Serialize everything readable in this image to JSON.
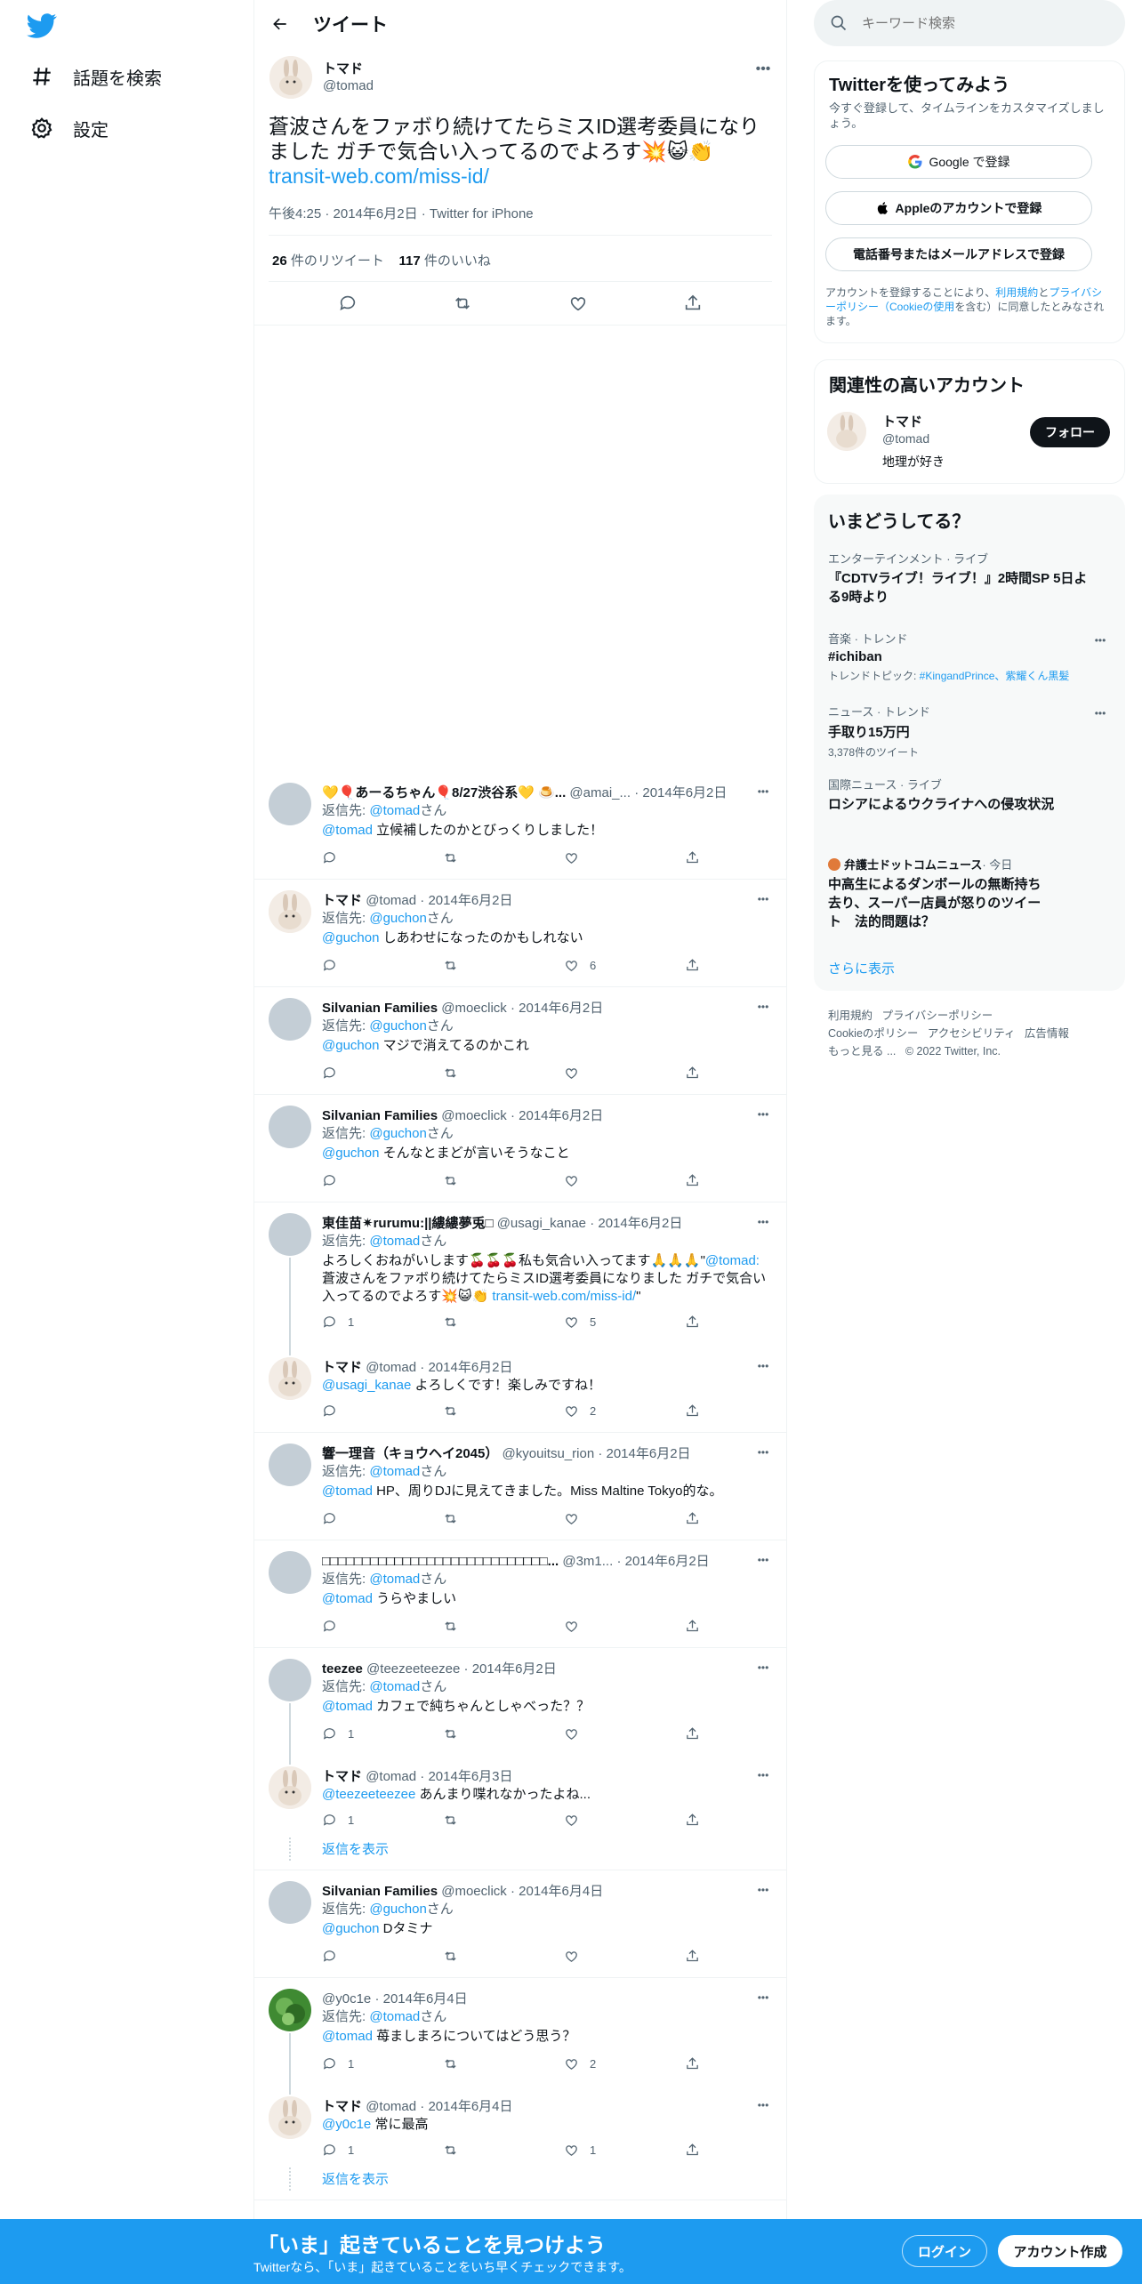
{
  "nav": {
    "explore_label": "話題を検索",
    "settings_label": "設定"
  },
  "header": {
    "title": "ツイート"
  },
  "main_tweet": {
    "name": "トマド",
    "handle": "@tomad",
    "text": "蒼波さんをファボり続けてたらミスID選考委員になりました ガチで気合い入ってるのでよろす💥😺👏",
    "link": "transit-web.com/miss-id/",
    "meta": "午後4:25 · 2014年6月2日 · Twitter for iPhone",
    "retweet_count": "26",
    "retweet_label": "件のリツイート",
    "like_count": "117",
    "like_label": "件のいいね"
  },
  "replies": [
    {
      "name": "💛🎈あーるちゃん🎈8/27渋谷系💛 🍮...",
      "handle": "@amai_...",
      "date": "· 2014年6月2日",
      "reply_prefix": "返信先:",
      "reply_to": "@tomad",
      "reply_suffix": "さん",
      "mention": "@tomad",
      "text": "立候補したのかとびっくりしました！",
      "replies": "",
      "likes": "",
      "avatar": "gray"
    },
    {
      "name": "トマド",
      "handle": "@tomad",
      "date": "· 2014年6月2日",
      "reply_prefix": "返信先:",
      "reply_to": "@guchon",
      "reply_suffix": "さん",
      "mention": "@guchon",
      "text": "しあわせになったのかもしれない",
      "replies": "",
      "likes": "6",
      "avatar": "rabbit"
    },
    {
      "name": "Silvanian Families",
      "handle": "@moeclick",
      "date": "· 2014年6月2日",
      "reply_prefix": "返信先:",
      "reply_to": "@guchon",
      "reply_suffix": "さん",
      "mention": "@guchon",
      "text": "マジで消えてるのかこれ",
      "replies": "",
      "likes": "",
      "avatar": "gray"
    },
    {
      "name": "Silvanian Families",
      "handle": "@moeclick",
      "date": "· 2014年6月2日",
      "reply_prefix": "返信先:",
      "reply_to": "@guchon",
      "reply_suffix": "さん",
      "mention": "@guchon",
      "text": "そんなとまどが言いそうなこと",
      "replies": "",
      "likes": "",
      "avatar": "gray"
    }
  ],
  "thread1": {
    "name": "東佳苗✷rurumu:||縷縷夢兎□",
    "handle": "@usagi_kanae",
    "date": "· 2014年6月2日",
    "reply_prefix": "返信先:",
    "reply_to": "@tomad",
    "reply_suffix": "さん",
    "text1": "よろしくおねがいします🍒🍒🍒私も気合い入ってます🙏🙏🙏\"",
    "mention": "@tomad:",
    "text2": "蒼波さんをファボり続けてたらミスID選考委員になりました ガチで気合い入ってるのでよろす💥😺👏",
    "link": "transit-web.com/miss-id/",
    "quote_end": "\"",
    "replies": "1",
    "likes": "5"
  },
  "thread1_reply": {
    "name": "トマド",
    "handle": "@tomad",
    "date": "· 2014年6月2日",
    "mention": "@usagi_kanae",
    "text": "よろしくです！楽しみですね！",
    "replies": "",
    "likes": "2"
  },
  "replies2": [
    {
      "name": "響一理音（キョウヘイ2045）",
      "handle": "@kyouitsu_rion",
      "date": "· 2014年6月2日",
      "reply_prefix": "返信先:",
      "reply_to": "@tomad",
      "reply_suffix": "さん",
      "mention": "@tomad",
      "text": "HP、周りDJに見えてきました。Miss Maltine Tokyo的な。",
      "replies": "",
      "likes": ""
    },
    {
      "name": "□□□□□□□□□□□□□□□□□□□□□□□□□□□□...",
      "handle": "@3m1...",
      "date": "· 2014年6月2日",
      "reply_prefix": "返信先:",
      "reply_to": "@tomad",
      "reply_suffix": "さん",
      "mention": "@tomad",
      "text": "うらやましい",
      "replies": "",
      "likes": ""
    }
  ],
  "thread2": {
    "name": "teezee",
    "handle": "@teezeeteezee",
    "date": "· 2014年6月2日",
    "reply_prefix": "返信先:",
    "reply_to": "@tomad",
    "reply_suffix": "さん",
    "mention": "@tomad",
    "text": "カフェで純ちゃんとしゃべった？？",
    "replies": "1",
    "likes": ""
  },
  "thread2_reply": {
    "name": "トマド",
    "handle": "@tomad",
    "date": "· 2014年6月3日",
    "mention": "@teezeeteezee",
    "text": "あんまり喋れなかったよね...",
    "replies": "1",
    "likes": ""
  },
  "show_replies": "返信を表示",
  "silvanian3": {
    "name": "Silvanian Families",
    "handle": "@moeclick",
    "date": "· 2014年6月4日",
    "reply_prefix": "返信先:",
    "reply_to": "@guchon",
    "reply_suffix": "さん",
    "mention": "@guchon",
    "text": "Dタミナ"
  },
  "thread3": {
    "name": "",
    "handle": "@y0c1e",
    "date": "· 2014年6月4日",
    "reply_prefix": "返信先:",
    "reply_to": "@tomad",
    "reply_suffix": "さん",
    "mention": "@tomad",
    "text": "苺ましまろについてはどう思う？",
    "replies": "1",
    "likes": "2"
  },
  "thread3_reply": {
    "name": "トマド",
    "handle": "@tomad",
    "date": "· 2014年6月4日",
    "mention": "@y0c1e",
    "text": "常に最高",
    "replies": "1",
    "likes": "1"
  },
  "search": {
    "placeholder": "キーワード検索"
  },
  "signup": {
    "title": "Twitterを使ってみよう",
    "subtitle": "今すぐ登録して、タイムラインをカスタマイズしましょう。",
    "google": "Google で登録",
    "apple": "Appleのアカウントで登録",
    "phone": "電話番号またはメールアドレスで登録",
    "terms_pre": "アカウントを登録することにより、",
    "terms_link": "利用規約",
    "terms_mid": "と",
    "privacy_link": "プライバシーポリシー",
    "cookie_link": "（Cookieの使用",
    "terms_post": "を含む）に同意したとみなされます。"
  },
  "related": {
    "title": "関連性の高いアカウント",
    "name": "トマド",
    "handle": "@tomad",
    "bio": "地理が好き",
    "follow": "フォロー"
  },
  "trends": {
    "title": "いまどうしてる？",
    "items": [
      {
        "context": "エンターテインメント · ライブ",
        "title": "『CDTVライブ！ライブ！』2時間SP 5日よる9時より"
      },
      {
        "context": "音楽 · トレンド",
        "title": "#ichiban",
        "sub_label": "トレンドトピック: ",
        "sub_links": "#KingandPrince、紫耀くん黒髪"
      },
      {
        "context": "ニュース · トレンド",
        "title": "手取り15万円",
        "sub": "3,378件のツイート"
      },
      {
        "context": "国際ニュース · ライブ",
        "title": "ロシアによるウクライナへの侵攻状況"
      },
      {
        "context_source": "弁護士ドットコムニュース",
        "context_time": " · 今日",
        "title": "中高生によるダンボールの無断持ち去り、スーパー店員が怒りのツイート　法的問題は？"
      }
    ],
    "more": "さらに表示"
  },
  "footer": {
    "l1": "利用規約",
    "l2": "プライバシーポリシー",
    "l3": "Cookieのポリシー",
    "l4": "アクセシビリティ",
    "l5": "広告情報",
    "l6": "もっと見る ...",
    "copy": "© 2022 Twitter, Inc."
  },
  "bottom_bar": {
    "title": "「いま」起きていることを見つけよう",
    "subtitle": "Twitterなら、「いま」起きていることをいち早くチェックできます。",
    "login": "ログイン",
    "signup": "アカウント作成"
  },
  "colors": {
    "accent": "#1d9bf0",
    "text": "#0f1419",
    "muted": "#536471"
  }
}
